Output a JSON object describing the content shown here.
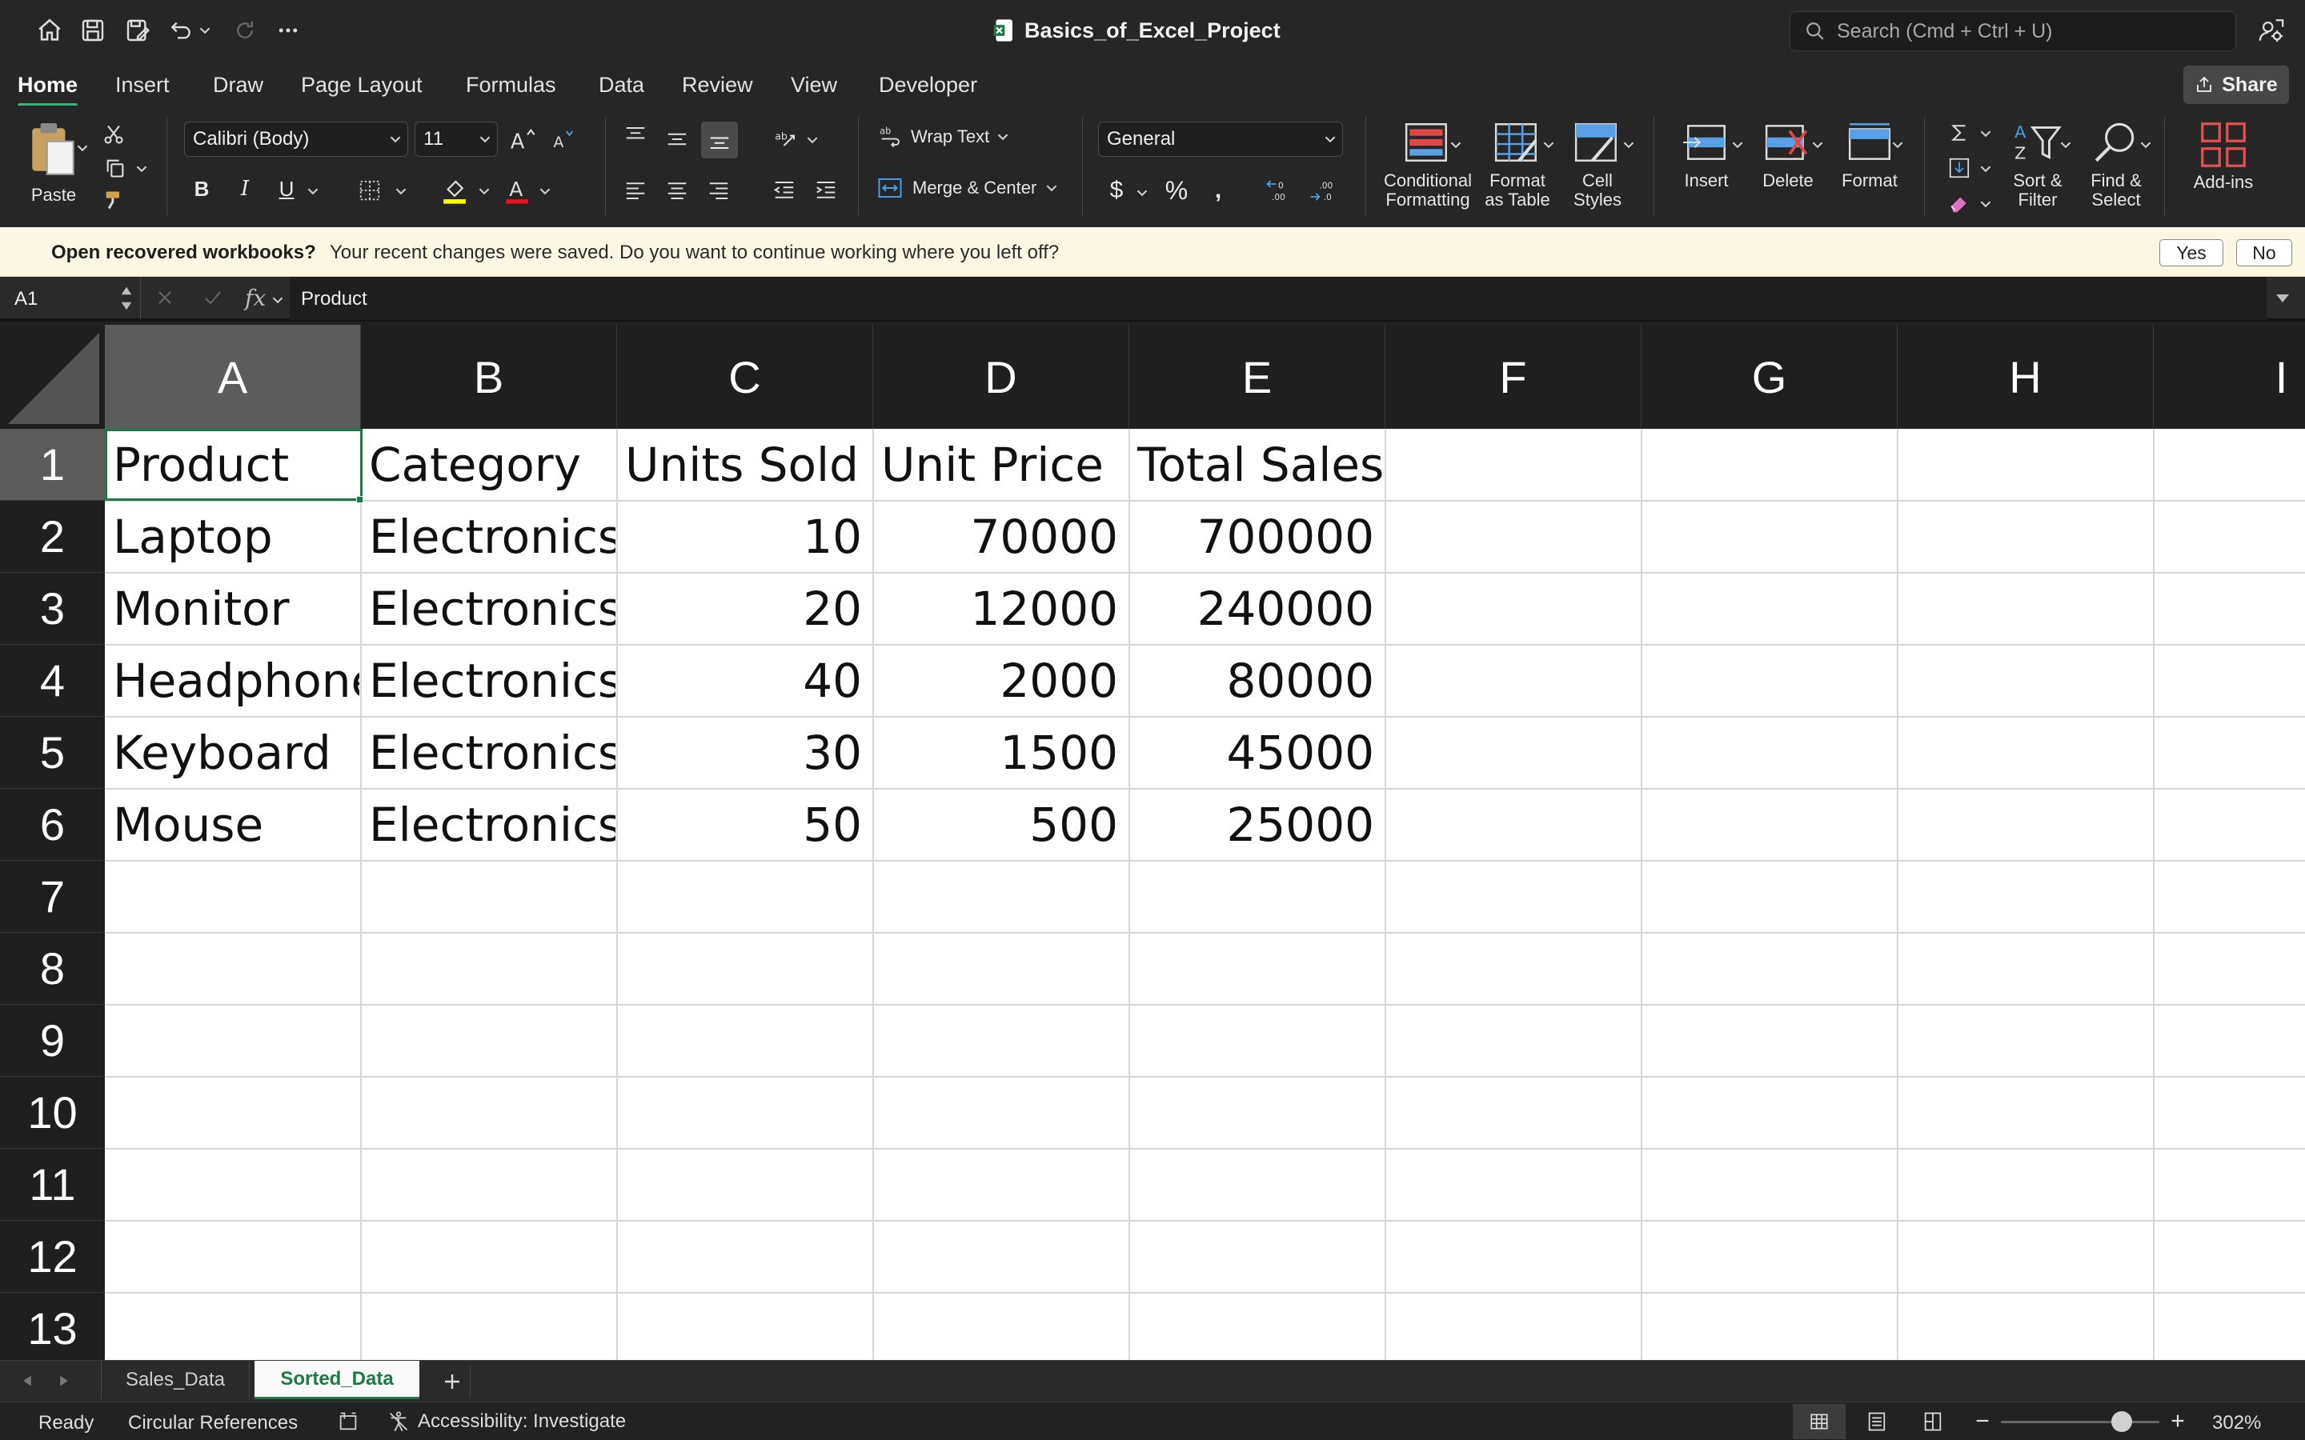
{
  "app": {
    "title": "Basics_of_Excel_Project",
    "search_placeholder": "Search (Cmd + Ctrl + U)",
    "share": "Share"
  },
  "tabs": [
    "Home",
    "Insert",
    "Draw",
    "Page Layout",
    "Formulas",
    "Data",
    "Review",
    "View",
    "Developer"
  ],
  "ribbon": {
    "paste": "Paste",
    "font_name": "Calibri (Body)",
    "font_size": "11",
    "wrap_text": "Wrap Text",
    "merge_center": "Merge & Center",
    "number_format": "General",
    "cond_fmt": [
      "Conditional",
      "Formatting"
    ],
    "fmt_table": [
      "Format",
      "as Table"
    ],
    "cell_styles": [
      "Cell",
      "Styles"
    ],
    "insert": "Insert",
    "delete": "Delete",
    "format": "Format",
    "sort_filter": [
      "Sort &",
      "Filter"
    ],
    "find_select": [
      "Find &",
      "Select"
    ],
    "addins": "Add-ins",
    "colors": {
      "highlight": "#ffff00",
      "font_color": "#e81123"
    }
  },
  "message": {
    "title": "Open recovered workbooks?",
    "text": "Your recent changes were saved. Do you want to continue working where you left off?",
    "yes": "Yes",
    "no": "No"
  },
  "formula_bar": {
    "name_box": "A1",
    "content": "Product"
  },
  "columns": [
    "A",
    "B",
    "C",
    "D",
    "E",
    "F",
    "G",
    "H",
    "I"
  ],
  "rows": [
    "1",
    "2",
    "3",
    "4",
    "5",
    "6",
    "7",
    "8",
    "9",
    "10",
    "11",
    "12",
    "13"
  ],
  "sheet": [
    [
      "Product",
      "Category",
      "Units Sold",
      "Unit Price",
      "Total Sales"
    ],
    [
      "Laptop",
      "Electronics",
      "10",
      "70000",
      "700000"
    ],
    [
      "Monitor",
      "Electronics",
      "20",
      "12000",
      "240000"
    ],
    [
      "Headphone",
      "Electronics",
      "40",
      "2000",
      "80000"
    ],
    [
      "Keyboard",
      "Electronics",
      "30",
      "1500",
      "45000"
    ],
    [
      "Mouse",
      "Electronics",
      "50",
      "500",
      "25000"
    ]
  ],
  "sheet_tabs": [
    "Sales_Data",
    "Sorted_Data"
  ],
  "status": {
    "ready": "Ready",
    "circular": "Circular References",
    "accessibility": "Accessibility: Investigate",
    "zoom": "302%"
  },
  "accent": "#1b7a45"
}
